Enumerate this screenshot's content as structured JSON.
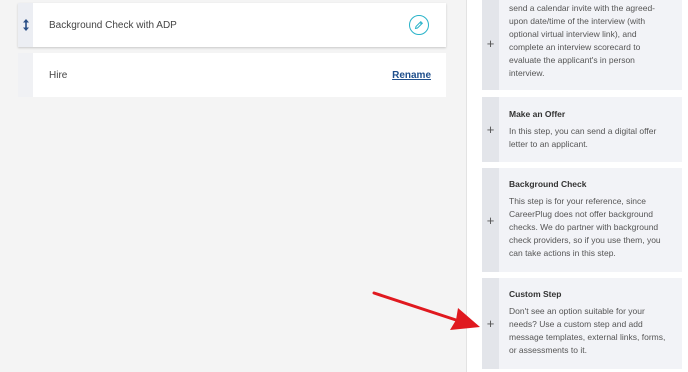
{
  "workflow_steps": [
    {
      "label": "Background Check with ADP"
    },
    {
      "label": "Hire",
      "action_label": "Rename"
    }
  ],
  "step_options": [
    {
      "title": "",
      "description_lines": [
        "send a calendar invite with the agreed-",
        "upon date/time of the interview (with",
        "optional virtual interview link), and",
        "complete an interview scorecard to",
        "evaluate the applicant's in person",
        "interview."
      ]
    },
    {
      "title": "Make an Offer",
      "description_lines": [
        "In this step, you can send a digital offer",
        "letter to an applicant."
      ]
    },
    {
      "title": "Background Check",
      "description_lines": [
        "This step is for your reference, since",
        "CareerPlug does not offer background",
        "checks. We do partner with background",
        "check providers, so if you use them, you",
        "can take actions in this step."
      ]
    },
    {
      "title": "Custom Step",
      "description_lines": [
        "Don't see an option suitable for your",
        "needs? Use a custom step and add",
        "message templates, external links, forms,",
        "or assessments to it."
      ]
    }
  ],
  "add_symbol": "+",
  "icons": {
    "drag_handle": "up-down-arrow-icon",
    "edit": "pencil-icon",
    "annotation": "red-arrow"
  },
  "colors": {
    "accent_teal": "#29b3c9",
    "link_blue": "#1f4f8c",
    "drag_handle": "#2a4f86",
    "annotation_arrow": "#e0191f"
  }
}
